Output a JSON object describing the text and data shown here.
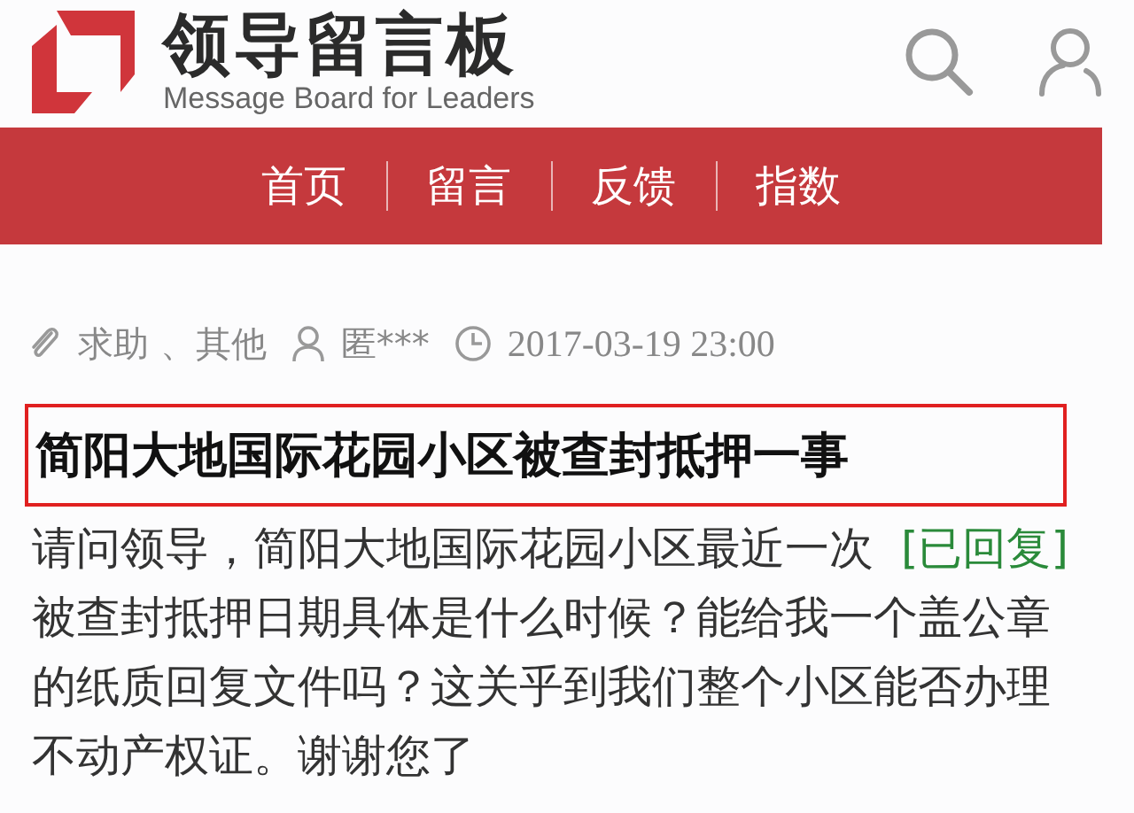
{
  "header": {
    "title": "领导留言板",
    "subtitle": "Message Board for Leaders"
  },
  "nav": [
    {
      "label": "首页"
    },
    {
      "label": "留言"
    },
    {
      "label": "反馈"
    },
    {
      "label": "指数"
    }
  ],
  "meta": {
    "category": "求助 、其他",
    "author": "匿***",
    "time": "2017-03-19 23:00"
  },
  "post": {
    "title": "简阳大地国际花园小区被查封抵押一事",
    "status": "[已回复]",
    "body_lines": [
      "请问领导，简阳大地国际花园小区最近一次",
      "被查封抵押日期具体是什么时候？能给我一个盖公章",
      "的纸质回复文件吗？这关乎到我们整个小区能否办理",
      "不动产权证。谢谢您了"
    ]
  }
}
